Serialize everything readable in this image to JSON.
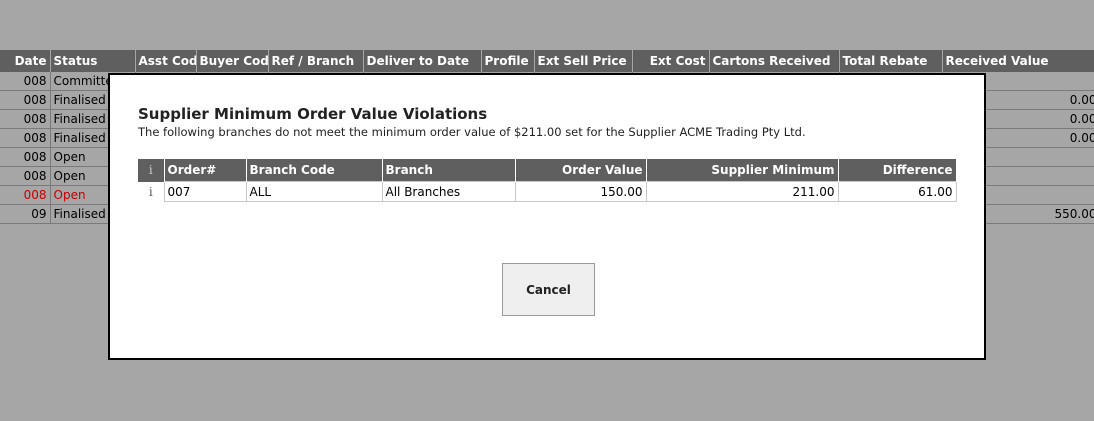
{
  "background_table": {
    "headers": [
      "Date",
      "Status",
      "Asst Code",
      "Buyer Code",
      "Ref / Branch",
      "Deliver to Date",
      "Profile",
      "Ext Sell Price",
      "Ext Cost",
      "Cartons Received",
      "Total Rebate",
      "Received Value"
    ],
    "rows": [
      {
        "date": "008",
        "status": "Committed",
        "received": ""
      },
      {
        "date": "008",
        "status": "Finalised",
        "received": "0.00"
      },
      {
        "date": "008",
        "status": "Finalised",
        "received": "0.00"
      },
      {
        "date": "008",
        "status": "Finalised",
        "received": "0.00"
      },
      {
        "date": "008",
        "status": "Open",
        "received": ""
      },
      {
        "date": "008",
        "status": "Open",
        "received": ""
      },
      {
        "date": "008",
        "status": "Open",
        "received": "",
        "highlight": true
      },
      {
        "date": "09",
        "status": "Finalised",
        "received": "550.00"
      }
    ]
  },
  "modal": {
    "title": "Supplier Minimum Order Value Violations",
    "description": "The following branches do not meet the minimum order value of $211.00 set for the Supplier ACME Trading Pty Ltd.",
    "table": {
      "info_glyph": "i",
      "headers": {
        "order": "Order#",
        "branch_code": "Branch Code",
        "branch": "Branch",
        "order_value": "Order Value",
        "supplier_minimum": "Supplier Minimum",
        "difference": "Difference"
      },
      "rows": [
        {
          "order": "007",
          "branch_code": "ALL",
          "branch": "All Branches",
          "order_value": "150.00",
          "supplier_minimum": "211.00",
          "difference": "61.00"
        }
      ]
    },
    "cancel_label": "Cancel"
  }
}
